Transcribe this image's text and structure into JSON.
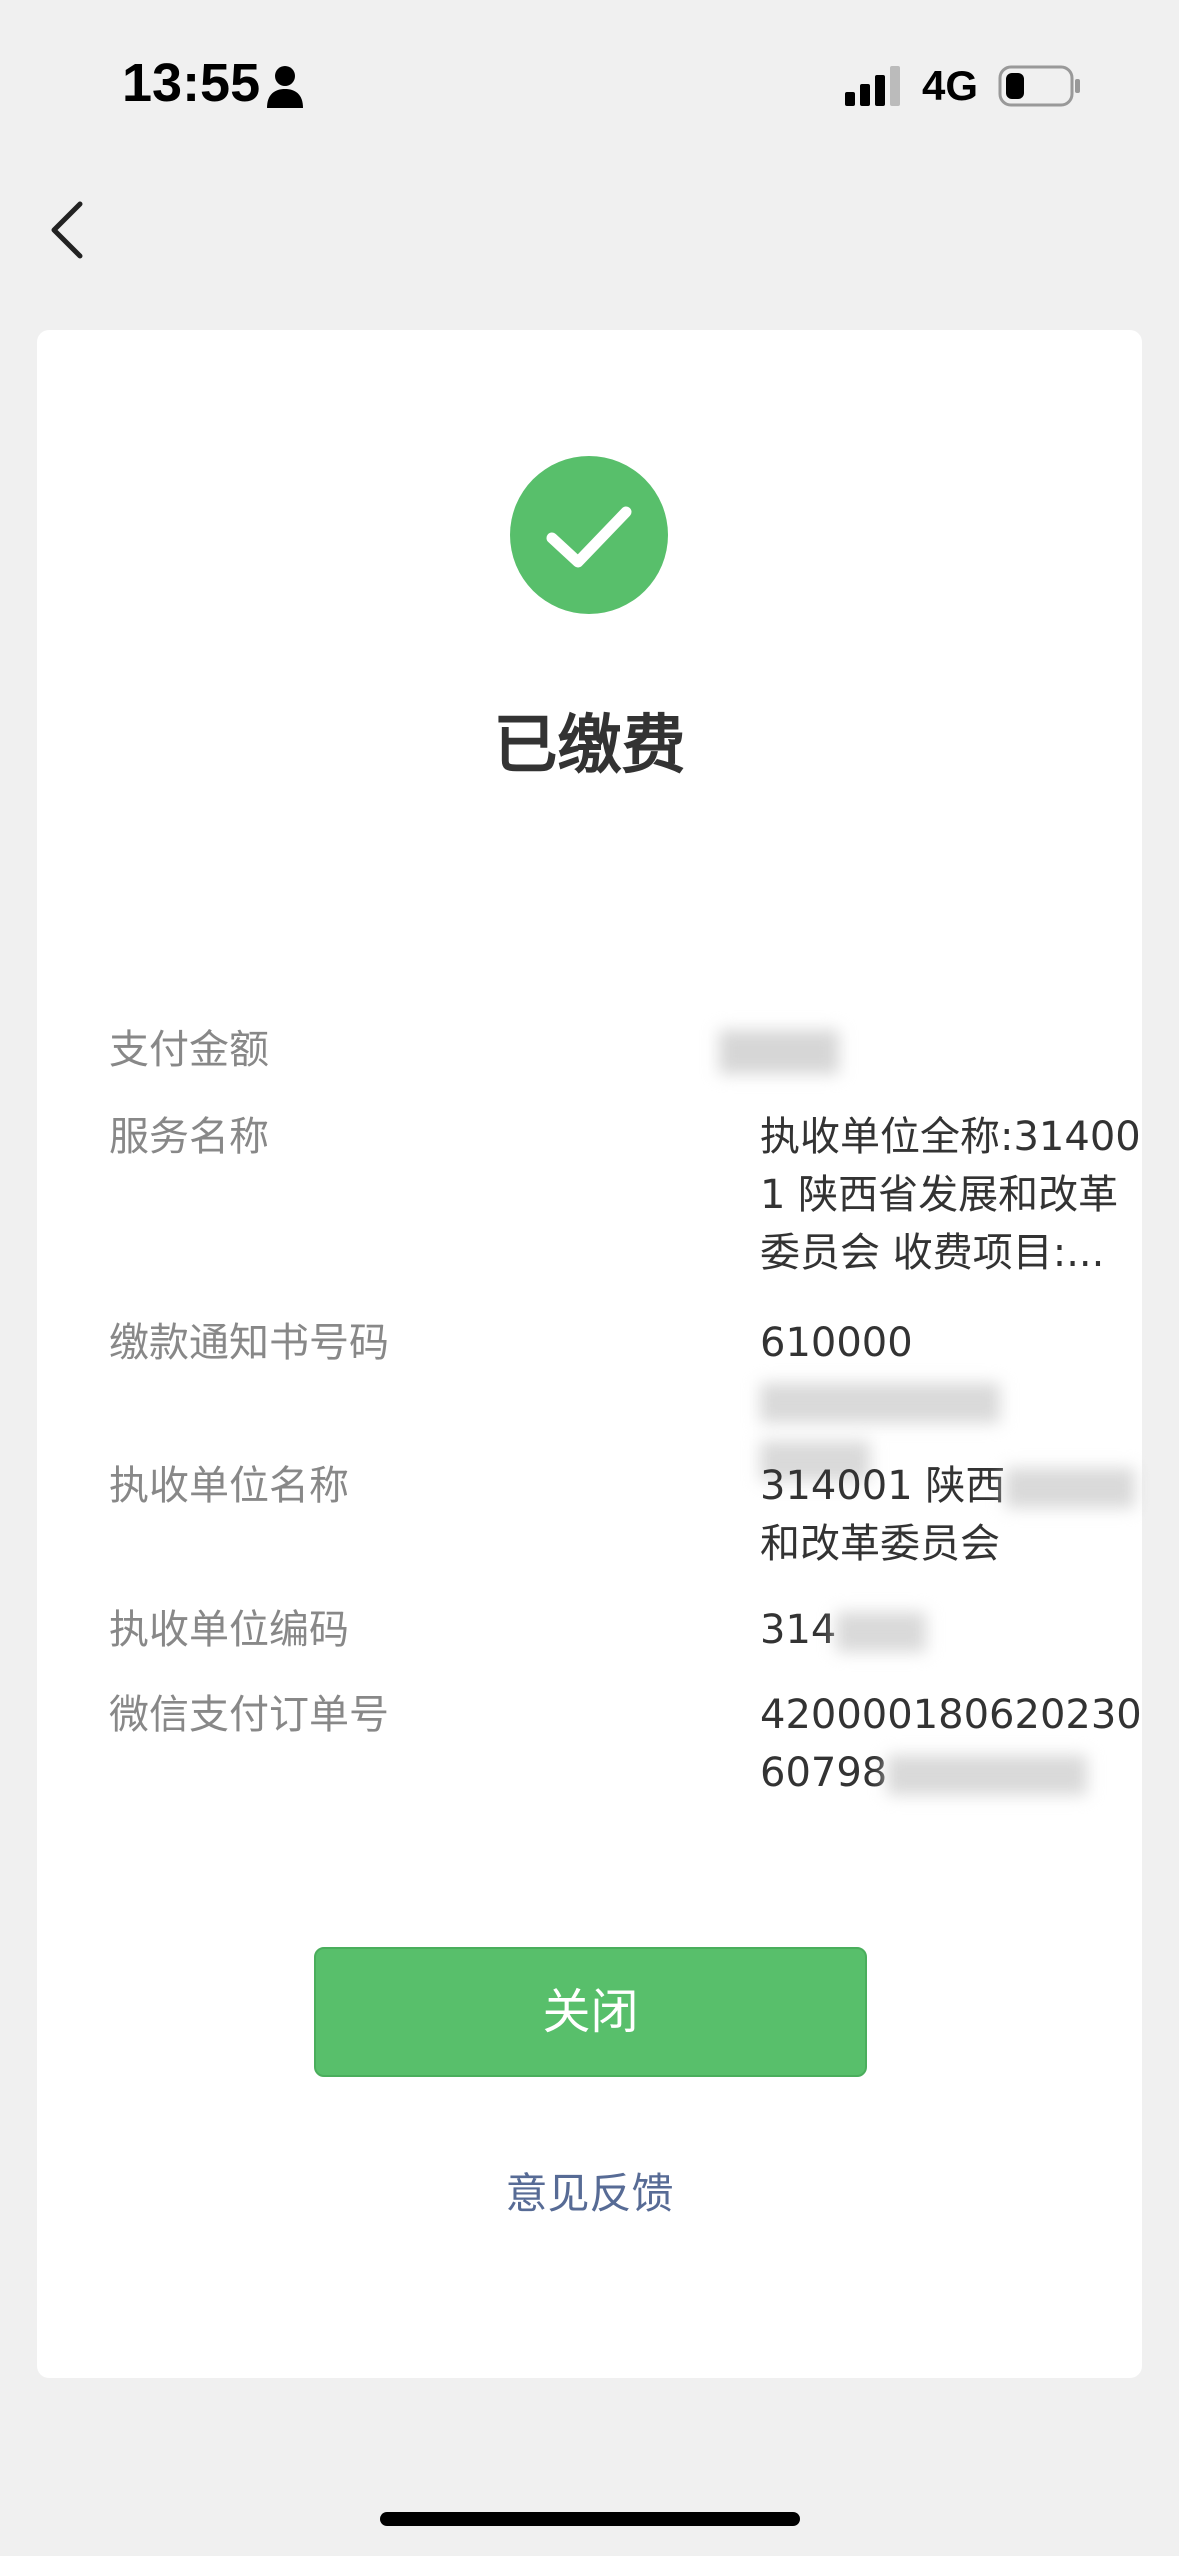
{
  "status_bar": {
    "time": "13:55",
    "network": "4G",
    "icons": [
      "person-icon",
      "signal-icon",
      "battery-icon"
    ]
  },
  "nav": {
    "back_icon": "chevron-left-icon"
  },
  "status": {
    "icon": "checkmark-circle-icon",
    "title": "已缴费",
    "accent_color": "#58bf6b"
  },
  "details": [
    {
      "label": "支付金额",
      "value": "",
      "masked": true
    },
    {
      "label": "服务名称",
      "value": "执收单位全称:314001 陕西省发展和改革委员会 收费项目:..."
    },
    {
      "label": "缴款通知书号码",
      "value": "610000",
      "masked_tail": true
    },
    {
      "label": "执收单位名称",
      "value": "314001 陕西",
      "tail": "和改革委员会",
      "masked_mid": true
    },
    {
      "label": "执收单位编码",
      "value": "314",
      "masked_tail": true
    },
    {
      "label": "微信支付订单号",
      "value": "420000180620230",
      "value_line2": "60798",
      "masked_tail": true
    }
  ],
  "actions": {
    "close_label": "关闭",
    "feedback_label": "意见反馈"
  },
  "colors": {
    "background": "#f0f0f0",
    "card": "#ffffff",
    "primary_button": "#58bf6b",
    "link": "#576b95",
    "label_text": "#888888"
  }
}
